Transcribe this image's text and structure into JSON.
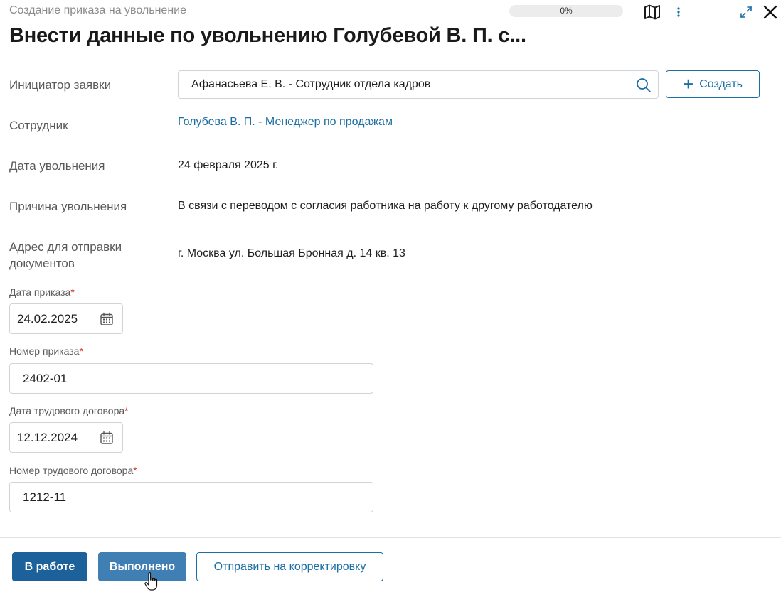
{
  "header": {
    "subtitle": "Создание приказа на увольнение",
    "progress": "0%",
    "progress_value": 0,
    "title": "Внести данные по увольнению Голубевой В. П. с..."
  },
  "icons": {
    "map": "map-icon",
    "more": "kebab-menu-icon",
    "expand": "expand-icon",
    "close": "close-icon",
    "search": "search-icon",
    "calendar": "calendar-icon",
    "plus": "plus-icon",
    "cursor": "hand-pointer-cursor"
  },
  "info": {
    "initiator_label": "Инициатор заявки",
    "initiator_value": "Афанасьева Е. В. - Сотрудник отдела кадров",
    "create_label": "Создать",
    "employee_label": "Сотрудник",
    "employee_value": "Голубева В. П. - Менеджер по продажам",
    "dismissal_date_label": "Дата увольнения",
    "dismissal_date_value": "24 февраля 2025 г.",
    "reason_label": "Причина увольнения",
    "reason_value": "В связи с переводом с согласия работника на работу к другому работодателю",
    "address_label_line1": "Адрес для отправки",
    "address_label_line2": "документов",
    "address_value": "г. Москва ул. Большая Бронная д. 14 кв. 13"
  },
  "form": {
    "order_date_label": "Дата приказа",
    "order_date_value": "24.02.2025",
    "order_number_label": "Номер приказа",
    "order_number_value": "2402-01",
    "contract_date_label": "Дата трудового договора",
    "contract_date_value": "12.12.2024",
    "contract_number_label": "Номер трудового договора",
    "contract_number_value": "1212-11",
    "required_mark": "*"
  },
  "actions": {
    "in_progress": "В работе",
    "done": "Выполнено",
    "send_for_correction": "Отправить на корректировку"
  },
  "colors": {
    "accent": "#1c6ea4",
    "primary_button": "#1c6199",
    "secondary_button": "#3f7fb4",
    "required": "#d0312d"
  }
}
